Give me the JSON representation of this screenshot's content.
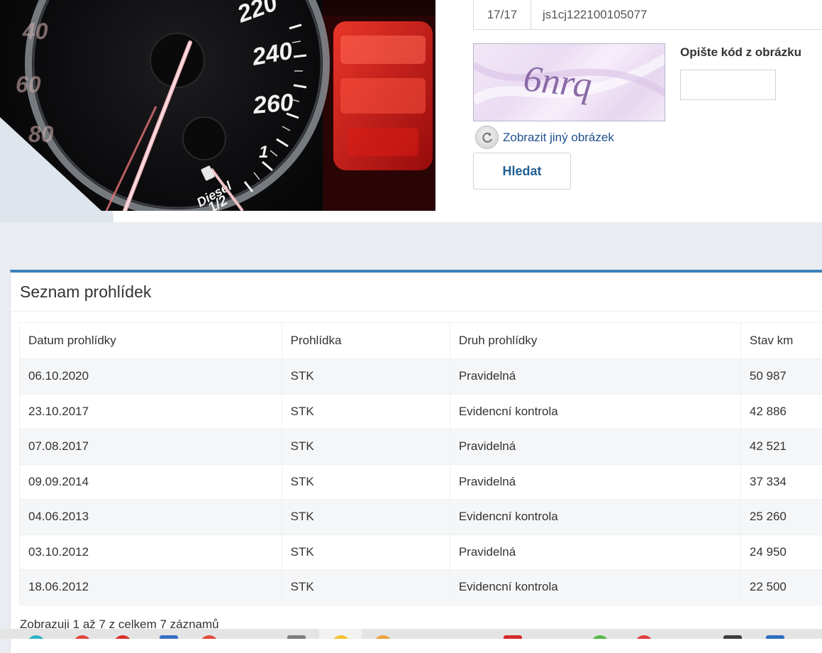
{
  "vin_table": {
    "count": "17/17",
    "vin": "js1cj122100105077"
  },
  "captcha": {
    "image_text": "6nrq",
    "label": "Opište kód z obrázku",
    "input_value": "",
    "refresh_label": "Zobrazit jiný obrázek",
    "search_label": "Hledat"
  },
  "speedometer": {
    "numbers": [
      "220",
      "240",
      "260",
      "1",
      "Diesel",
      "1/2",
      "40",
      "60",
      "80"
    ]
  },
  "inspections": {
    "title": "Seznam prohlídek",
    "headers": [
      "Datum prohlídky",
      "Prohlídka",
      "Druh prohlídky",
      "Stav km"
    ],
    "rows": [
      [
        "06.10.2020",
        "STK",
        "Pravidelná",
        "50 987"
      ],
      [
        "23.10.2017",
        "STK",
        "Evidencní kontrola",
        "42 886"
      ],
      [
        "07.08.2017",
        "STK",
        "Pravidelná",
        "42 521"
      ],
      [
        "09.09.2014",
        "STK",
        "Pravidelná",
        "37 334"
      ],
      [
        "04.06.2013",
        "STK",
        "Evidencní kontrola",
        "25 260"
      ],
      [
        "03.10.2012",
        "STK",
        "Pravidelná",
        "24 950"
      ],
      [
        "18.06.2012",
        "STK",
        "Evidencní kontrola",
        "22 500"
      ]
    ],
    "info": "Zobrazuji 1 až 7 z celkem 7 záznamů"
  },
  "colors": {
    "accent": "#3d82b9",
    "link": "#1f4f8c",
    "button_text": "#1f5e92",
    "page_bg": "#e9edf1"
  }
}
